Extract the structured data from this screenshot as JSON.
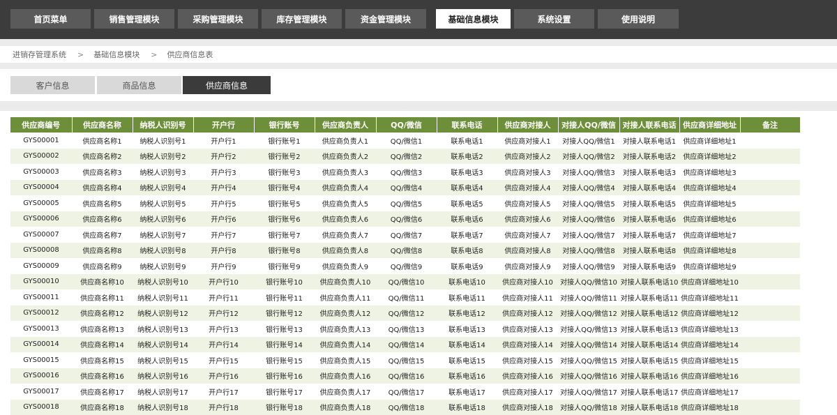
{
  "nav": [
    {
      "label": "首页菜单",
      "active": false
    },
    {
      "label": "销售管理模块",
      "active": false
    },
    {
      "label": "采购管理模块",
      "active": false
    },
    {
      "label": "库存管理模块",
      "active": false
    },
    {
      "label": "资金管理模块",
      "active": false
    },
    {
      "label": "基础信息模块",
      "active": true
    },
    {
      "label": "系统设置",
      "active": false
    },
    {
      "label": "使用说明",
      "active": false
    }
  ],
  "breadcrumb": {
    "items": [
      "进销存管理系统",
      "基础信息模块",
      "供应商信息表"
    ],
    "separator": ">"
  },
  "tabs": [
    {
      "label": "客户信息",
      "active": false
    },
    {
      "label": "商品信息",
      "active": false
    },
    {
      "label": "供应商信息",
      "active": true
    }
  ],
  "table": {
    "headers": [
      "供应商编号",
      "供应商名称",
      "纳税人识别号",
      "开户行",
      "银行账号",
      "供应商负责人",
      "QQ/微信",
      "联系电话",
      "供应商对接人",
      "对接人QQ/微信",
      "对接人联系电话",
      "供应商详细地址",
      "备注"
    ],
    "rows": [
      [
        "GYS00001",
        "供应商名称1",
        "纳税人识别号1",
        "开户行1",
        "银行账号1",
        "供应商负责人1",
        "QQ/微信1",
        "联系电话1",
        "供应商对接人1",
        "对接人QQ/微信1",
        "对接人联系电话1",
        "供应商详细地址1",
        ""
      ],
      [
        "GYS00002",
        "供应商名称2",
        "纳税人识别号2",
        "开户行2",
        "银行账号2",
        "供应商负责人2",
        "QQ/微信2",
        "联系电话2",
        "供应商对接人2",
        "对接人QQ/微信2",
        "对接人联系电话2",
        "供应商详细地址2",
        ""
      ],
      [
        "GYS00003",
        "供应商名称3",
        "纳税人识别号3",
        "开户行3",
        "银行账号3",
        "供应商负责人3",
        "QQ/微信3",
        "联系电话3",
        "供应商对接人3",
        "对接人QQ/微信3",
        "对接人联系电话3",
        "供应商详细地址3",
        ""
      ],
      [
        "GYS00004",
        "供应商名称4",
        "纳税人识别号4",
        "开户行4",
        "银行账号4",
        "供应商负责人4",
        "QQ/微信4",
        "联系电话4",
        "供应商对接人4",
        "对接人QQ/微信4",
        "对接人联系电话4",
        "供应商详细地址4",
        ""
      ],
      [
        "GYS00005",
        "供应商名称5",
        "纳税人识别号5",
        "开户行5",
        "银行账号5",
        "供应商负责人5",
        "QQ/微信5",
        "联系电话5",
        "供应商对接人5",
        "对接人QQ/微信5",
        "对接人联系电话5",
        "供应商详细地址5",
        ""
      ],
      [
        "GYS00006",
        "供应商名称6",
        "纳税人识别号6",
        "开户行6",
        "银行账号6",
        "供应商负责人6",
        "QQ/微信6",
        "联系电话6",
        "供应商对接人6",
        "对接人QQ/微信6",
        "对接人联系电话6",
        "供应商详细地址6",
        ""
      ],
      [
        "GYS00007",
        "供应商名称7",
        "纳税人识别号7",
        "开户行7",
        "银行账号7",
        "供应商负责人7",
        "QQ/微信7",
        "联系电话7",
        "供应商对接人7",
        "对接人QQ/微信7",
        "对接人联系电话7",
        "供应商详细地址7",
        ""
      ],
      [
        "GYS00008",
        "供应商名称8",
        "纳税人识别号8",
        "开户行8",
        "银行账号8",
        "供应商负责人8",
        "QQ/微信8",
        "联系电话8",
        "供应商对接人8",
        "对接人QQ/微信8",
        "对接人联系电话8",
        "供应商详细地址8",
        ""
      ],
      [
        "GYS00009",
        "供应商名称9",
        "纳税人识别号9",
        "开户行9",
        "银行账号9",
        "供应商负责人9",
        "QQ/微信9",
        "联系电话9",
        "供应商对接人9",
        "对接人QQ/微信9",
        "对接人联系电话9",
        "供应商详细地址9",
        ""
      ],
      [
        "GYS00010",
        "供应商名称10",
        "纳税人识别号10",
        "开户行10",
        "银行账号10",
        "供应商负责人10",
        "QQ/微信10",
        "联系电话10",
        "供应商对接人10",
        "对接人QQ/微信10",
        "对接人联系电话10",
        "供应商详细地址10",
        ""
      ],
      [
        "GYS00011",
        "供应商名称11",
        "纳税人识别号11",
        "开户行11",
        "银行账号11",
        "供应商负责人11",
        "QQ/微信11",
        "联系电话11",
        "供应商对接人11",
        "对接人QQ/微信11",
        "对接人联系电话11",
        "供应商详细地址11",
        ""
      ],
      [
        "GYS00012",
        "供应商名称12",
        "纳税人识别号12",
        "开户行12",
        "银行账号12",
        "供应商负责人12",
        "QQ/微信12",
        "联系电话12",
        "供应商对接人12",
        "对接人QQ/微信12",
        "对接人联系电话12",
        "供应商详细地址12",
        ""
      ],
      [
        "GYS00013",
        "供应商名称13",
        "纳税人识别号13",
        "开户行13",
        "银行账号13",
        "供应商负责人13",
        "QQ/微信13",
        "联系电话13",
        "供应商对接人13",
        "对接人QQ/微信13",
        "对接人联系电话13",
        "供应商详细地址13",
        ""
      ],
      [
        "GYS00014",
        "供应商名称14",
        "纳税人识别号14",
        "开户行14",
        "银行账号14",
        "供应商负责人14",
        "QQ/微信14",
        "联系电话14",
        "供应商对接人14",
        "对接人QQ/微信14",
        "对接人联系电话14",
        "供应商详细地址14",
        ""
      ],
      [
        "GYS00015",
        "供应商名称15",
        "纳税人识别号15",
        "开户行15",
        "银行账号15",
        "供应商负责人15",
        "QQ/微信15",
        "联系电话15",
        "供应商对接人15",
        "对接人QQ/微信15",
        "对接人联系电话15",
        "供应商详细地址15",
        ""
      ],
      [
        "GYS00016",
        "供应商名称16",
        "纳税人识别号16",
        "开户行16",
        "银行账号16",
        "供应商负责人16",
        "QQ/微信16",
        "联系电话16",
        "供应商对接人16",
        "对接人QQ/微信16",
        "对接人联系电话16",
        "供应商详细地址16",
        ""
      ],
      [
        "GYS00017",
        "供应商名称17",
        "纳税人识别号17",
        "开户行17",
        "银行账号17",
        "供应商负责人17",
        "QQ/微信17",
        "联系电话17",
        "供应商对接人17",
        "对接人QQ/微信17",
        "对接人联系电话17",
        "供应商详细地址17",
        ""
      ],
      [
        "GYS00018",
        "供应商名称18",
        "纳税人识别号18",
        "开户行18",
        "银行账号18",
        "供应商负责人18",
        "QQ/微信18",
        "联系电话18",
        "供应商对接人18",
        "对接人QQ/微信18",
        "对接人联系电话18",
        "供应商详细地址18",
        ""
      ]
    ]
  },
  "colors": {
    "topbar": "#3c3c3c",
    "nav_button": "#5a5a5a",
    "nav_active": "#ffffff",
    "tab_inactive": "#d9d9d9",
    "tab_active": "#3b3b3b",
    "header_green": "#6e8f3a",
    "row_alt": "#eef3e3"
  }
}
